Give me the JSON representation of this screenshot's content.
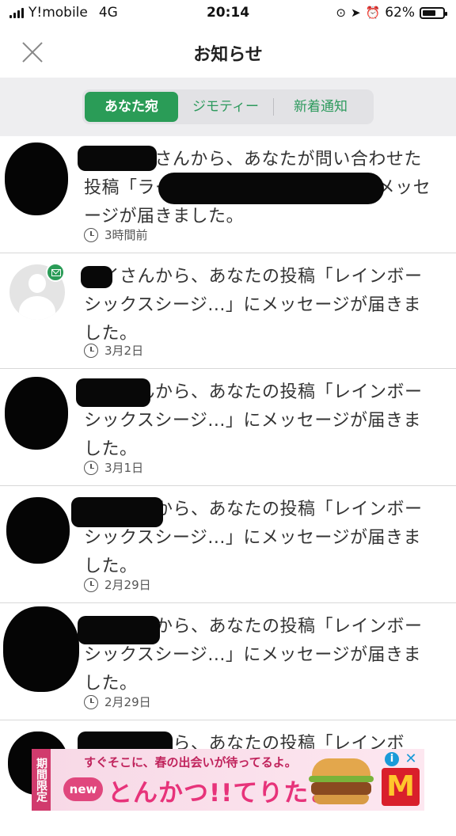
{
  "status_bar": {
    "carrier": "Y!mobile",
    "network": "4G",
    "time": "20:14",
    "battery": "62%"
  },
  "header": {
    "title": "お知らせ"
  },
  "tabs": [
    {
      "label": "あなた宛",
      "active": true
    },
    {
      "label": "ジモティー",
      "active": false
    },
    {
      "label": "新着通知",
      "active": false
    }
  ],
  "notifications": [
    {
      "message": "ダイズンさんから、あなたが問い合わせた投稿「ラーメン食べに行こうよ。」にメッセージが届きました。",
      "time": "3時間前"
    },
    {
      "message": "セイさんから、あなたの投稿「レインボーシックスシージ...」にメッセージが届きました。",
      "time": "3月2日"
    },
    {
      "message": "ひろさんから、あなたの投稿「レインボーシックスシージ...」にメッセージが届きました。",
      "time": "3月1日"
    },
    {
      "message": "ひろさんから、あなたの投稿「レインボーシックスシージ...」にメッセージが届きました。",
      "time": "2月29日"
    },
    {
      "message": "ひろさんから、あなたの投稿「レインボーシックスシージ...」にメッセージが届きました。",
      "time": "2月29日"
    },
    {
      "message": "ひろさんから、あなたの投稿「レインボ",
      "time": ""
    }
  ],
  "ad": {
    "tagline": "すぐそこに、春の出会いが待ってるよ。",
    "badge": "new",
    "headline": "とんかつ!!てりたま",
    "limited": "期間限定",
    "brand_mark": "M"
  },
  "colors": {
    "accent": "#2a9c57",
    "ad_pink": "#e7337a"
  }
}
